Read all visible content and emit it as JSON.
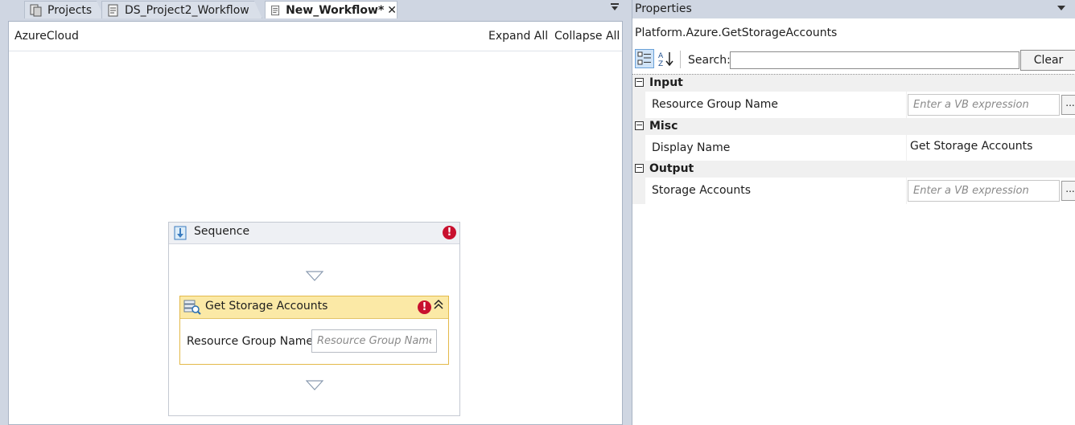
{
  "tabs": [
    {
      "label": "Projects",
      "icon": "projects-icon"
    },
    {
      "label": "DS_Project2_Workflow",
      "icon": "workflow-file-icon"
    },
    {
      "label": "New_Workflow*",
      "icon": "workflow-file-icon",
      "active": true,
      "close": "✕"
    }
  ],
  "designer": {
    "breadcrumb": "AzureCloud",
    "expand_all": "Expand All",
    "collapse_all": "Collapse All",
    "sequence": {
      "title": "Sequence",
      "error": "!",
      "activity": {
        "title": "Get Storage Accounts",
        "error": "!",
        "collapse_glyph": "⌃",
        "field_label": "Resource Group Name",
        "field_placeholder": "Resource Group Name"
      }
    }
  },
  "properties": {
    "panel_title": "Properties",
    "object_name": "Platform.Azure.GetStorageAccounts",
    "search_label": "Search:",
    "clear_label": "Clear",
    "categories": [
      {
        "label": "Input",
        "toggle": "−",
        "rows": [
          {
            "name": "Resource Group Name",
            "placeholder": "Enter a VB expression",
            "button": "..."
          }
        ]
      },
      {
        "label": "Misc",
        "toggle": "−",
        "rows": [
          {
            "name": "Display Name",
            "value": "Get Storage Accounts"
          }
        ]
      },
      {
        "label": "Output",
        "toggle": "−",
        "rows": [
          {
            "name": "Storage Accounts",
            "placeholder": "Enter a VB expression",
            "button": "..."
          }
        ]
      }
    ]
  },
  "colors": {
    "chrome": "#cfd6e2",
    "activity_header": "#fbe9a6",
    "activity_border": "#e3b94a",
    "error": "#c8102e"
  }
}
